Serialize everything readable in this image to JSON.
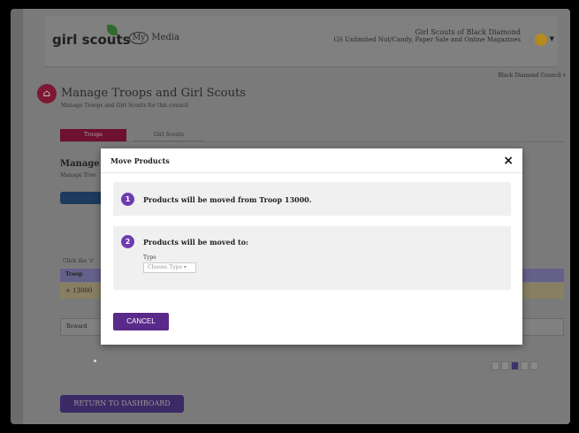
{
  "header": {
    "logo_text": "girl scouts",
    "mymedia_circle": "My",
    "mymedia_text": "Media",
    "council_name": "Girl Scouts of Black Diamond",
    "council_line2": "GS Unlimited Nut/Candy, Paper Sale and Online Magazines"
  },
  "page": {
    "council_select": "Black Diamond Council v",
    "title": "Manage Troops and Girl Scouts",
    "subtitle": "Manage Troops and Girl Scouts for this council",
    "tabs": [
      "Troops",
      "Girl Scouts"
    ],
    "section_heading": "Manage Y",
    "section_sub": "Manage Troo",
    "click_hint": "Click the 'v'",
    "table_header": "Troop",
    "table_row": "+ 13000",
    "reward_text": "Reward",
    "return_label": "RETURN TO DASHBOARD"
  },
  "modal": {
    "title": "Move Products",
    "close_glyph": "×",
    "step1_num": "1",
    "step1_text": "Products will be moved from Troop 13000.",
    "step2_num": "2",
    "step2_text": "Products will be moved to:",
    "type_label": "Type",
    "type_placeholder": "Choose Type ▾",
    "cancel_label": "CANCEL"
  },
  "colors": {
    "accent_purple": "#6d3cb0",
    "cancel_purple": "#5a2a8a",
    "brand_maroon": "#7d1733"
  }
}
